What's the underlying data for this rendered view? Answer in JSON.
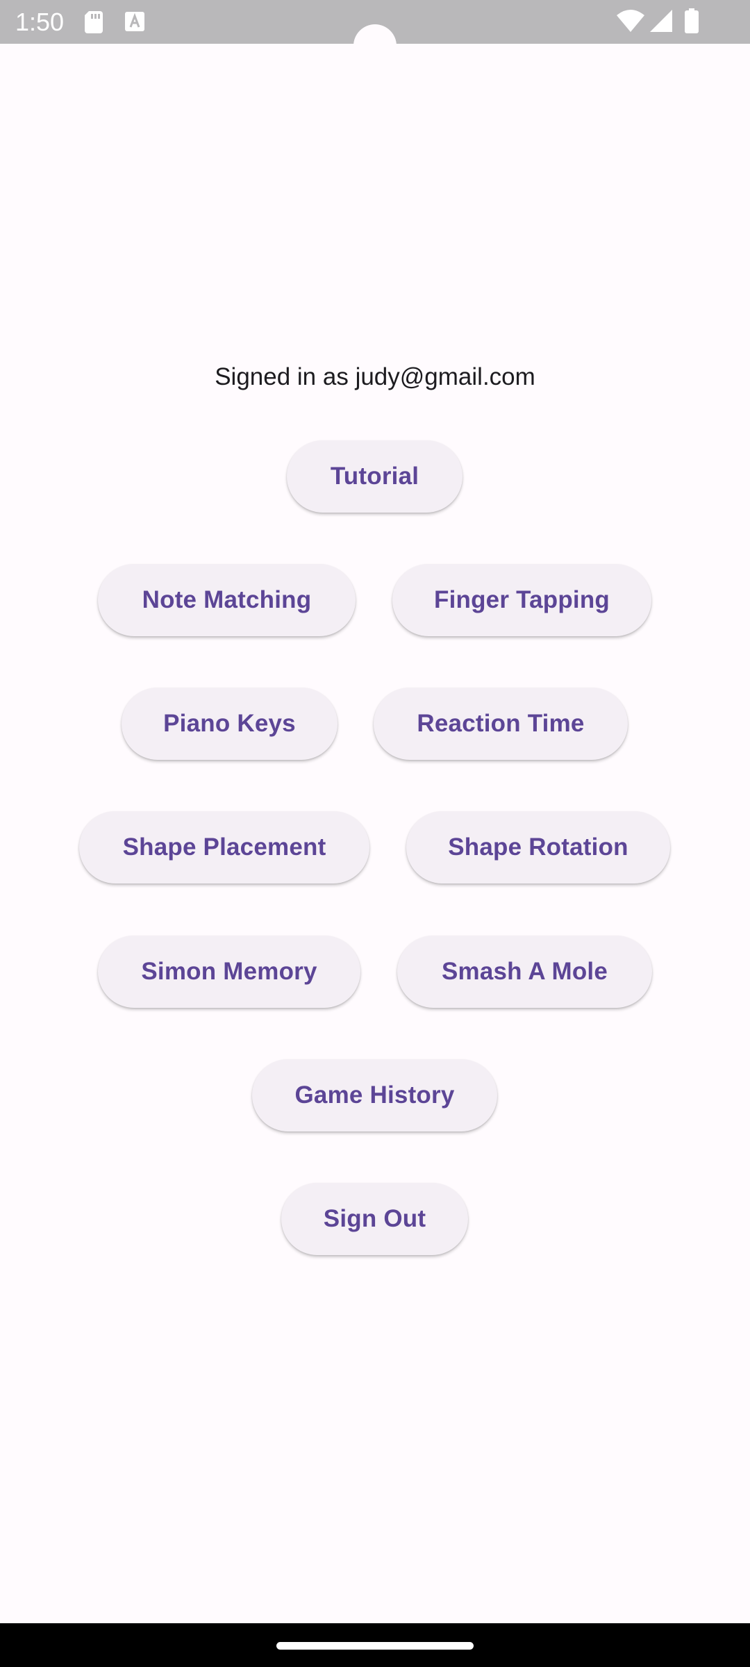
{
  "status_bar": {
    "time": "1:50",
    "icons": [
      "sd-card-icon",
      "a-icon",
      "wifi-icon",
      "signal-icon",
      "battery-icon"
    ]
  },
  "main": {
    "signed_in_text": "Signed in as judy@gmail.com",
    "buttons": {
      "tutorial": "Tutorial",
      "note_matching": "Note Matching",
      "finger_tapping": "Finger Tapping",
      "piano_keys": "Piano Keys",
      "reaction_time": "Reaction Time",
      "shape_placement": "Shape Placement",
      "shape_rotation": "Shape Rotation",
      "simon_memory": "Simon Memory",
      "smash_a_mole": "Smash A Mole",
      "game_history": "Game History",
      "sign_out": "Sign Out"
    }
  },
  "colors": {
    "background": "#fffbfe",
    "button_bg": "#f4eff5",
    "button_text": "#5c4596",
    "status_bar": "#b9b8ba"
  }
}
